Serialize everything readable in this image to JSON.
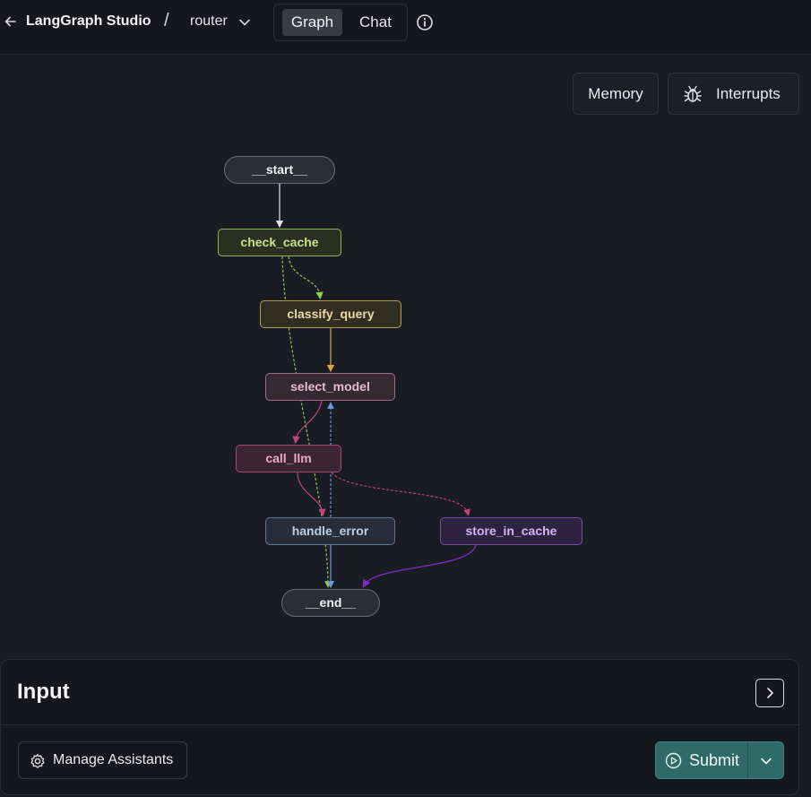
{
  "header": {
    "app_title": "LangGraph Studio",
    "separator": "/",
    "graph_name": "router",
    "tabs": [
      {
        "label": "Graph",
        "active": true
      },
      {
        "label": "Chat",
        "active": false
      }
    ],
    "icons": [
      "back-arrow-icon",
      "chevron-down-icon",
      "info-icon"
    ]
  },
  "canvas_controls": {
    "memory_label": "Memory",
    "interrupts_label": "Interrupts",
    "interrupts_icon": "bug-icon"
  },
  "graph": {
    "nodes": {
      "start": "__start__",
      "check_cache": "check_cache",
      "classify_query": "classify_query",
      "select_model": "select_model",
      "call_llm": "call_llm",
      "handle_error": "handle_error",
      "store_in_cache": "store_in_cache",
      "end": "__end__"
    },
    "edges": [
      {
        "from": "__start__",
        "to": "check_cache",
        "style": "solid"
      },
      {
        "from": "check_cache",
        "to": "classify_query",
        "style": "dashed"
      },
      {
        "from": "check_cache",
        "to": "__end__",
        "style": "dashed"
      },
      {
        "from": "classify_query",
        "to": "select_model",
        "style": "solid"
      },
      {
        "from": "select_model",
        "to": "call_llm",
        "style": "solid"
      },
      {
        "from": "call_llm",
        "to": "handle_error",
        "style": "solid"
      },
      {
        "from": "call_llm",
        "to": "store_in_cache",
        "style": "dashed"
      },
      {
        "from": "handle_error",
        "to": "select_model",
        "style": "dashed"
      },
      {
        "from": "handle_error",
        "to": "__end__",
        "style": "solid"
      },
      {
        "from": "store_in_cache",
        "to": "__end__",
        "style": "solid"
      }
    ],
    "colors": {
      "check_cache": "#90b25a",
      "classify_query": "#b59a55",
      "select_model": "#a06b88",
      "call_llm": "#c2467a",
      "handle_error": "#5f8ac6",
      "store_in_cache": "#7a2fbf"
    }
  },
  "input_panel": {
    "title": "Input",
    "manage_assistants_label": "Manage Assistants",
    "submit_label": "Submit",
    "icons": [
      "expand-icon",
      "gear-icon",
      "play-icon",
      "chevron-down-icon"
    ],
    "accent": "#2f6b66"
  }
}
